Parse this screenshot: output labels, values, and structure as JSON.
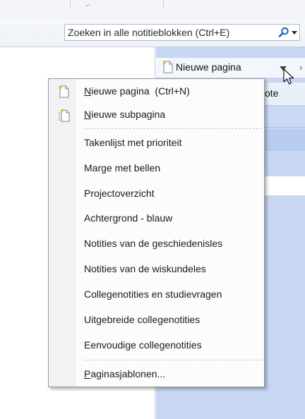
{
  "search": {
    "placeholder": "Zoeken in alle notitieblokken (Ctrl+E)"
  },
  "toolbar": {
    "new_page_label": "Nieuwe pagina",
    "collapse_glyph": "›"
  },
  "pages_pane": {
    "header_label": "ote"
  },
  "menu": {
    "new_page": {
      "accel": "N",
      "rest": "ieuwe pagina",
      "shortcut": "(Ctrl+N)"
    },
    "new_subpage": {
      "accel": "N",
      "rest": "ieuwe subpagina"
    },
    "templates": [
      "Takenlijst met prioriteit",
      "Marge met bellen",
      "Projectoverzicht",
      "Achtergrond - blauw",
      "Notities van de geschiedenisles",
      "Notities van de wiskundeles",
      "Collegenotities en studievragen",
      "Uitgebreide collegenotities",
      "Eenvoudige collegenotities"
    ],
    "page_templates": {
      "accel": "P",
      "rest": "aginasjablonen..."
    }
  },
  "colors": {
    "pages_pane_bg": "#c7d6f1",
    "search_icon": "#1a5fc7",
    "menu_border": "#979797"
  }
}
